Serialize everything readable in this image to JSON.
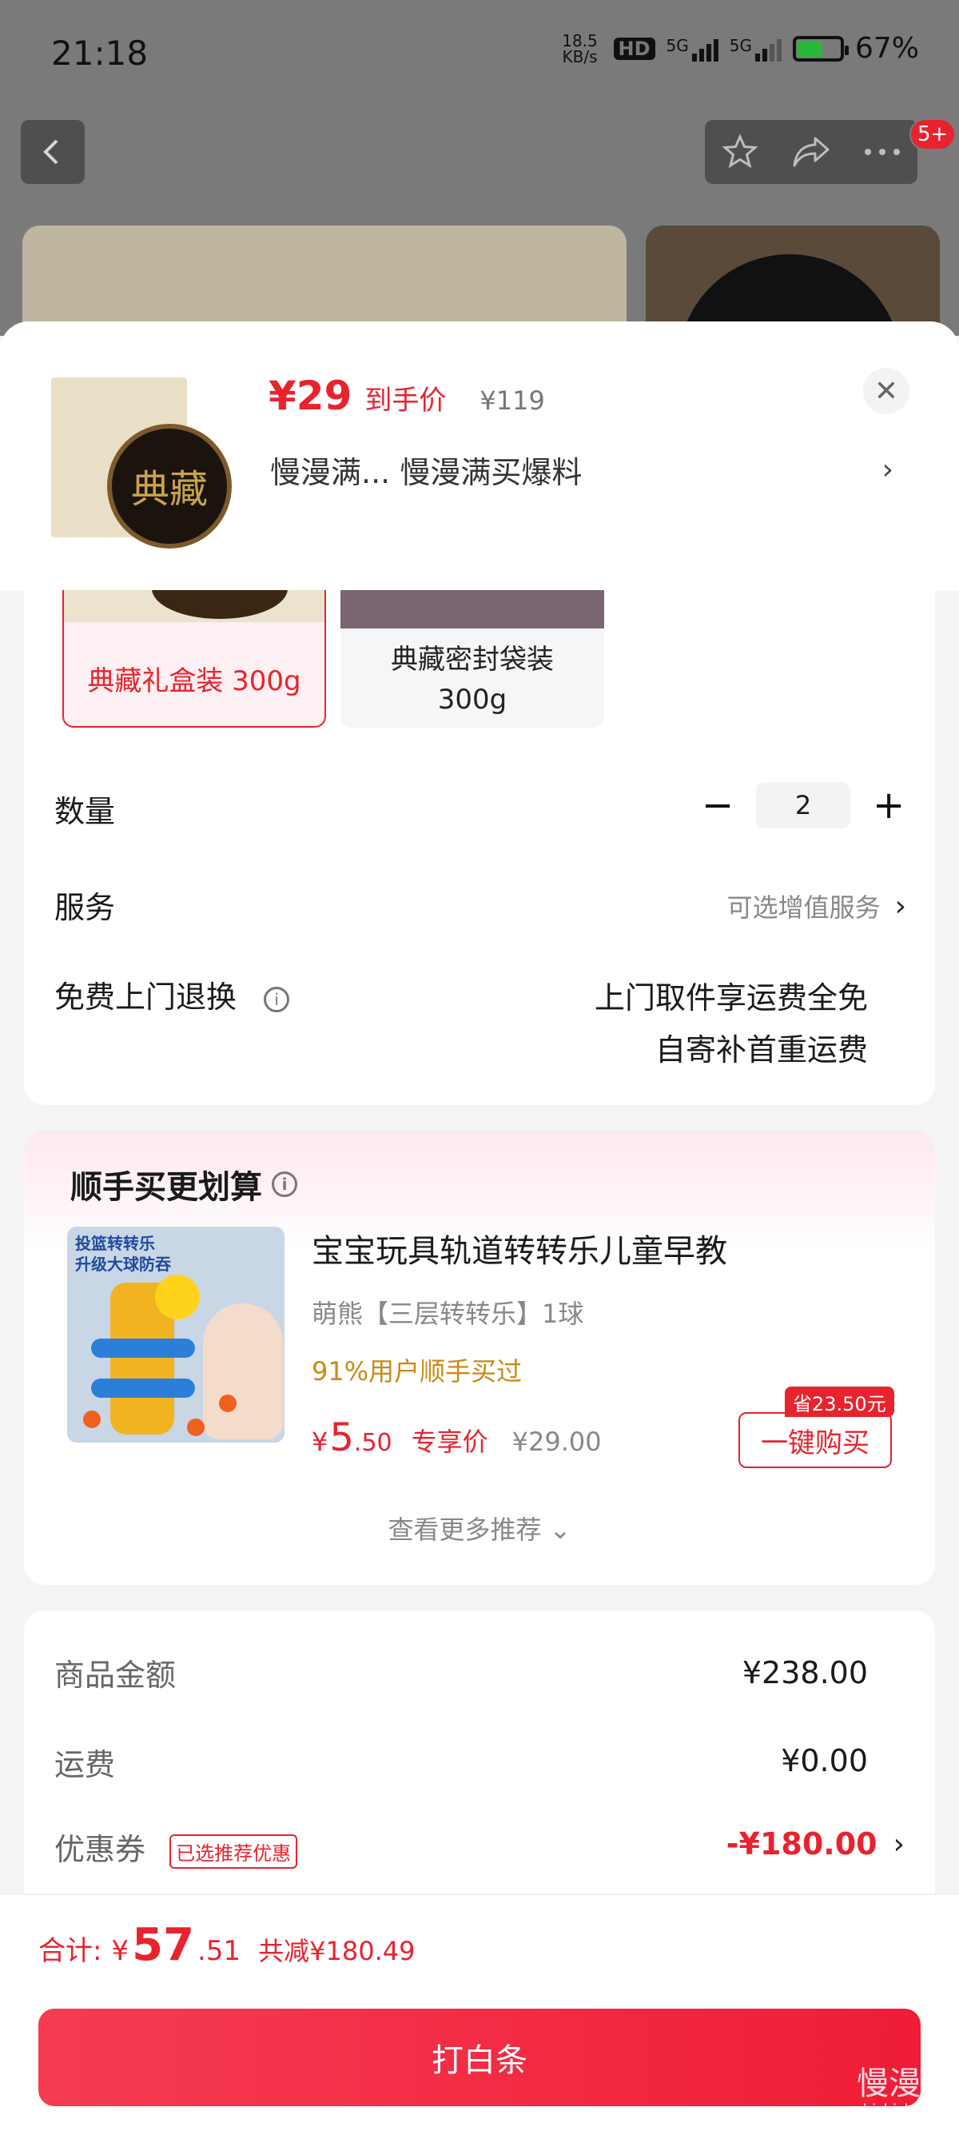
{
  "status_bar": {
    "time": "21:18",
    "net_speed": "18.5 KB/s",
    "hd": "HD",
    "sig1": "5G",
    "sig2": "5G",
    "battery": "67%"
  },
  "header": {
    "cart_badge": "5+"
  },
  "sheet": {
    "price": "¥29",
    "price_tag": "到手价",
    "original_price": "¥119",
    "product_desc": "慢漫满... 慢漫满买爆料",
    "desc_chevron": "›",
    "close_icon_glyph": "✕",
    "thumb_text": "典藏"
  },
  "options": [
    {
      "label": "典藏礼盒装 300g",
      "selected": true
    },
    {
      "label_line1": "典藏密封袋装",
      "label_line2": "300g",
      "selected": false
    }
  ],
  "quantity": {
    "label": "数量",
    "value": "2",
    "minus": "−",
    "plus": "+"
  },
  "service": {
    "label": "服务",
    "value": "可选增值服务",
    "chevron": "›"
  },
  "free_return": {
    "label": "免费上门退换",
    "info": "i",
    "line1": "上门取件享运费全免",
    "line2": "自寄补首重运费"
  },
  "recommend": {
    "title": "顺手买更划算",
    "info": "i",
    "image_tag_line1": "投篮转转乐",
    "image_tag_line2": "升级大球防吞",
    "name": "宝宝玩具轨道转转乐儿童早教",
    "spec": "萌熊【三层转转乐】1球",
    "bought": "91%用户顺手买过",
    "price_symbol": "¥",
    "price_int": "5",
    "price_dec": ".50",
    "price_tag": "专享价",
    "original_price": "¥29.00",
    "save_badge": "省23.50元",
    "buy_button": "一键购买",
    "more": "查看更多推荐 ⌄"
  },
  "summary": {
    "goods_label": "商品金额",
    "goods_value": "¥238.00",
    "shipping_label": "运费",
    "shipping_value": "¥0.00",
    "coupon_label": "优惠券",
    "coupon_tag": "已选推荐优惠",
    "coupon_value": "-¥180.00",
    "coupon_chevron": "›"
  },
  "footer": {
    "total_label": "合计:",
    "total_symbol": "¥",
    "total_int": "57",
    "total_dec": ".51",
    "saved": "共减¥180.49",
    "pay_button": "打白条"
  },
  "watermark": {
    "text": "慢漫满",
    "sub": "zhizhizhi.com"
  },
  "colors": {
    "accent": "#e8232e",
    "bought": "#c98a12"
  }
}
